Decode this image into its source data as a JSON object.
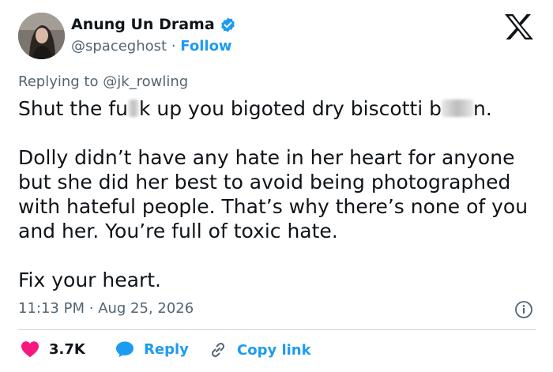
{
  "author": {
    "display_name": "Anung Un Drama",
    "handle": "@spaceghost",
    "separator": "·",
    "follow_label": "Follow"
  },
  "replying_to": {
    "prefix": "Replying to",
    "mention": "@jk_rowling"
  },
  "tweet": {
    "line1_part1": "Shut the fu",
    "line1_part2": "k up you bigoted dry biscotti b",
    "line1_part3": "n.",
    "paragraph2": "Dolly didn’t have any hate in her heart for anyone but she did her best to avoid being photographed with hateful people. That’s why there’s none of you and her. You’re full of toxic hate.",
    "paragraph3": "Fix your heart."
  },
  "meta": {
    "time": "11:13 PM",
    "separator": "·",
    "date": "Aug 25, 2026"
  },
  "actions": {
    "likes_count": "3.7K",
    "reply_label": "Reply",
    "copy_link_label": "Copy link"
  },
  "icons": {
    "verified": "verified-badge-icon",
    "brand": "x-logo-icon",
    "info": "info-icon",
    "like": "heart-icon",
    "reply": "speech-bubble-icon",
    "link": "link-icon"
  },
  "colors": {
    "accent": "#1d9bf0",
    "like": "#f91880",
    "secondary_text": "#536471"
  }
}
